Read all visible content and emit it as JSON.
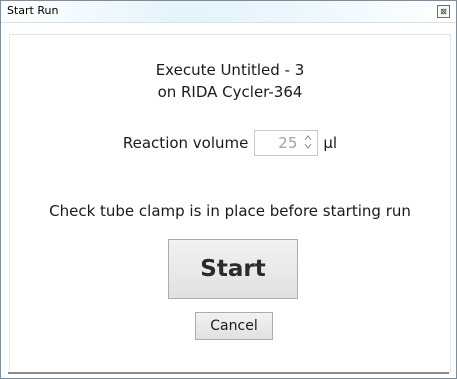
{
  "window": {
    "title": "Start Run",
    "close_glyph": "⊠"
  },
  "dialog": {
    "execute_line": "Execute Untitled - 3",
    "device_line": "on RIDA Cycler-364",
    "volume_label": "Reaction volume",
    "volume_value": "25",
    "volume_unit": "µl",
    "spin_glyph": "⌃⌄",
    "check_message": "Check tube clamp is in place before starting run",
    "start_label": "Start",
    "cancel_label": "Cancel"
  },
  "colors": {
    "title_gradient_accent": "#e3f4fb",
    "disabled_text": "#a3a3a3",
    "button_face": "#e1e1e1"
  },
  "icons": {
    "close": "close-icon",
    "spinner": "spinner-arrows-icon"
  }
}
